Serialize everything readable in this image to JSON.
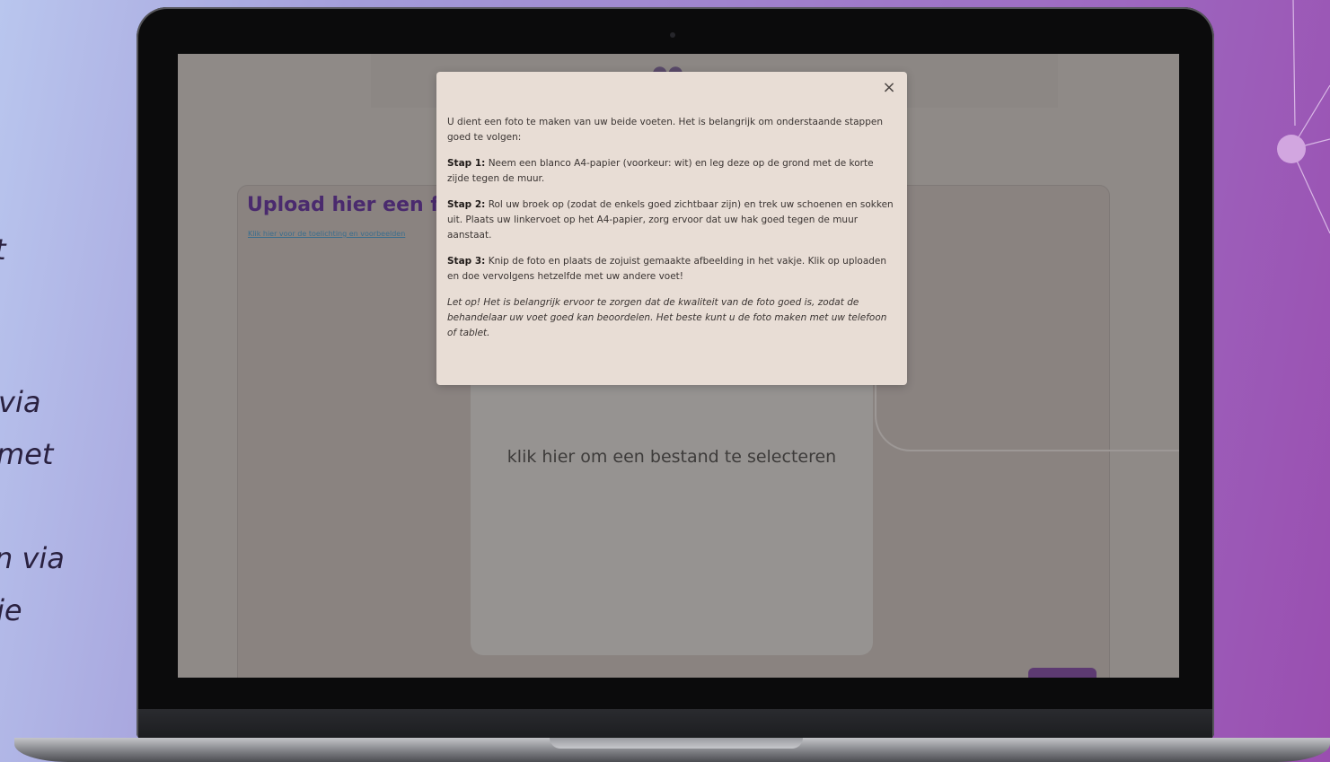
{
  "side_fragments": [
    "t",
    "via",
    "met",
    "n via",
    "je"
  ],
  "page": {
    "card_title": "Upload hier een fo",
    "card_link": "Klik hier voor de toelichting en voorbeelden",
    "dropzone_label": "klik hier om een bestand te selecteren"
  },
  "modal": {
    "close_label": "×",
    "intro": "U dient een foto te maken van uw beide voeten. Het is belangrijk om onderstaande stappen goed te volgen:",
    "steps": [
      {
        "label": "Stap 1:",
        "text": "Neem een blanco A4-papier (voorkeur: wit) en leg deze op de grond met de korte zijde tegen de muur."
      },
      {
        "label": "Stap 2:",
        "text": "Rol uw broek op (zodat de enkels goed zichtbaar zijn) en trek uw schoenen en sokken uit. Plaats uw linkervoet op het A4-papier, zorg ervoor dat uw hak goed tegen de muur aanstaat."
      },
      {
        "label": "Stap 3:",
        "text": "Knip de foto en plaats de zojuist gemaakte afbeelding in het vakje. Klik op uploaden en doe vervolgens hetzelfde met uw andere voet!"
      }
    ],
    "note": "Let op! Het is belangrijk ervoor te zorgen dat de kwaliteit van de foto goed is, zodat de behandelaar uw voet goed kan beoordelen. Het beste kunt u de foto maken met uw telefoon of tablet."
  }
}
